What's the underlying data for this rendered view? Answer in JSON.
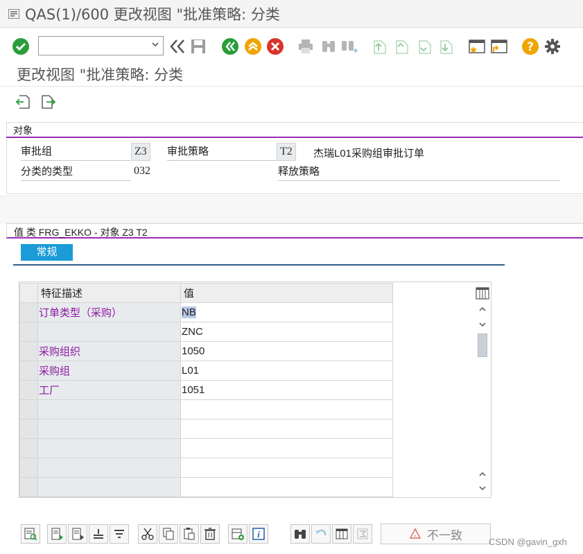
{
  "window": {
    "title": "QAS(1)/600 更改视图 \"批准策略: 分类"
  },
  "toolbar": {
    "command_field_value": "",
    "icons": [
      "check-icon",
      "dropdown-icon",
      "back-history-icon",
      "save-icon",
      "back-icon",
      "exit-icon",
      "cancel-icon",
      "print-icon",
      "find-icon",
      "find-next-icon",
      "first-page-icon",
      "previous-page-icon",
      "next-page-icon",
      "last-page-icon",
      "create-session-icon",
      "shortcut-icon",
      "help-icon",
      "settings-icon"
    ]
  },
  "page": {
    "title": "更改视图 \"批准策略: 分类"
  },
  "object_section": {
    "heading": "对象",
    "release_group_label": "审批组",
    "release_group_value": "Z3",
    "release_strategy_label": "审批策略",
    "release_strategy_value": "T2",
    "release_strategy_desc": "杰瑞L01采购组审批订单",
    "class_type_label": "分类的类型",
    "class_type_value": "032",
    "release_strategy_field_label": "释放策略"
  },
  "values_section": {
    "heading": "值 类 FRG_EKKO - 对象 Z3 T2",
    "tab_general": "常规",
    "col_characteristic": "特征描述",
    "col_value": "值",
    "rows": [
      {
        "feature": "订单类型（采购）",
        "value": "NB"
      },
      {
        "feature": "",
        "value": "ZNC"
      },
      {
        "feature": "采购组织",
        "value": "1050"
      },
      {
        "feature": "采购组",
        "value": "L01"
      },
      {
        "feature": "工厂",
        "value": "1051"
      },
      {
        "feature": "",
        "value": ""
      },
      {
        "feature": "",
        "value": ""
      },
      {
        "feature": "",
        "value": ""
      },
      {
        "feature": "",
        "value": ""
      },
      {
        "feature": "",
        "value": ""
      }
    ]
  },
  "bottom_toolbar": {
    "inconsistent_label": "不一致"
  },
  "watermark": "CSDN @gavin_gxh",
  "colors": {
    "accent": "#9b2bb5",
    "tab": "#1b9bd7",
    "check": "#2a9d3a",
    "nav_green": "#2a9d3a",
    "orange": "#f0a500",
    "red": "#d9342b"
  }
}
